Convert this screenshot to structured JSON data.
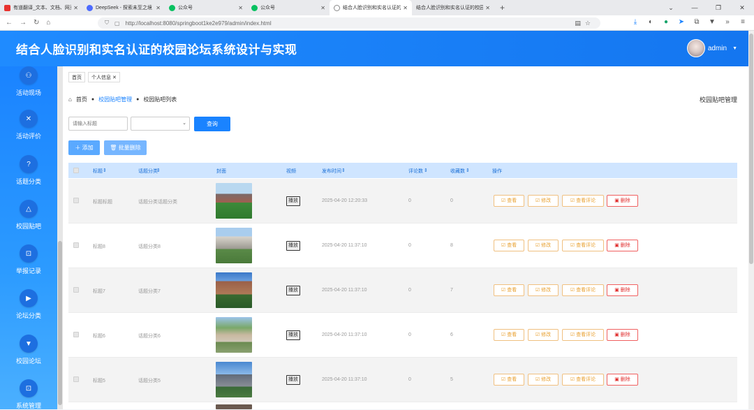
{
  "browser": {
    "tabs": [
      {
        "title": "有道翻译_文本、文档、网页、沉",
        "color": "#e8322e"
      },
      {
        "title": "DeepSeek - 探索未至之境",
        "color": "#4d6bfe"
      },
      {
        "title": "公众号",
        "color": "#07c160"
      },
      {
        "title": "公众号",
        "color": "#07c160"
      },
      {
        "title": "结合人脸识别和实名认证的校园",
        "color": "#888888"
      },
      {
        "title": "结合人脸识别和实名认证的校园论坛",
        "color": "#888888"
      }
    ],
    "new_tab": "+",
    "url": "http://localhost:8080/springboot1ke2e979/admin/index.html"
  },
  "header": {
    "title": "结合人脸识别和实名认证的校园论坛系统设计与实现",
    "user": "admin"
  },
  "sidebar": {
    "items": [
      {
        "label": "活动现场",
        "icon": "user-icon"
      },
      {
        "label": "活动评价",
        "icon": "close-icon"
      },
      {
        "label": "话题分类",
        "icon": "help-icon"
      },
      {
        "label": "校园贴吧",
        "icon": "bell-icon"
      },
      {
        "label": "举报记录",
        "icon": "scan-icon"
      },
      {
        "label": "论坛分类",
        "icon": "play-icon"
      },
      {
        "label": "校园论坛",
        "icon": "dropdown-icon"
      },
      {
        "label": "系统管理",
        "icon": "scan-icon"
      }
    ]
  },
  "content_tabs": {
    "home": "首页",
    "profile": "个人信息"
  },
  "breadcrumb": {
    "home": "首页",
    "level1": "校园贴吧管理",
    "level2": "校园贴吧列表",
    "right": "校园贴吧管理"
  },
  "search": {
    "placeholder": "请输入标题",
    "query_label": "查询",
    "add_label": "添加",
    "batch_delete_label": "批量删除"
  },
  "table": {
    "headers": [
      "标题",
      "话题分类",
      "封面",
      "视频",
      "发布时间",
      "评论数",
      "收藏数",
      "操作"
    ],
    "actions": {
      "view": "查看",
      "edit": "修改",
      "comments": "查看评论",
      "delete": "删除",
      "play": "播放"
    },
    "rows": [
      {
        "title": "标题标题",
        "category": "话题分类话题分类",
        "time": "2025-04-20 12:20:33",
        "comments": "0",
        "favorites": "0"
      },
      {
        "title": "标题8",
        "category": "话题分类8",
        "time": "2025-04-20 11:37:10",
        "comments": "0",
        "favorites": "8"
      },
      {
        "title": "标题7",
        "category": "话题分类7",
        "time": "2025-04-20 11:37:10",
        "comments": "0",
        "favorites": "7"
      },
      {
        "title": "标题6",
        "category": "话题分类6",
        "time": "2025-04-20 11:37:10",
        "comments": "0",
        "favorites": "6"
      },
      {
        "title": "标题5",
        "category": "话题分类5",
        "time": "2025-04-20 11:37:10",
        "comments": "0",
        "favorites": "5"
      }
    ]
  },
  "colors": {
    "accent": "#1a83ff",
    "warn": "#e8a030",
    "danger": "#e03030"
  }
}
